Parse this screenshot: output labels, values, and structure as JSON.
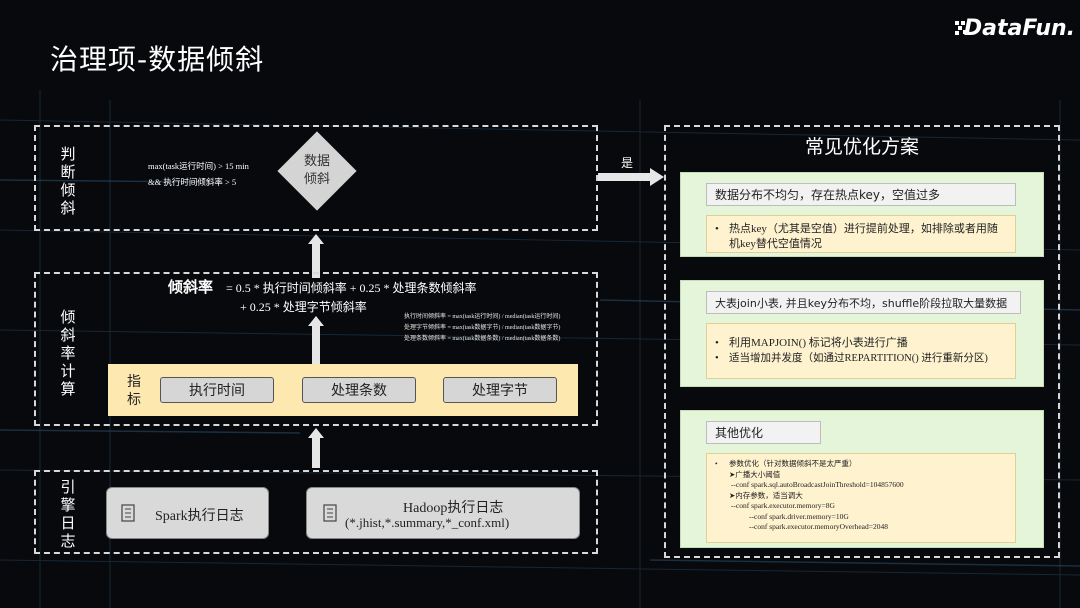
{
  "slide": {
    "title": "治理项-数据倾斜",
    "logo_text": "DataFun."
  },
  "judge": {
    "label": "判断倾斜",
    "condition_line1": "max(task运行时间) > 15 min",
    "condition_line2": "&&  执行时间倾斜率 > 5",
    "decision_line1": "数据",
    "decision_line2": "倾斜",
    "yes_label": "是"
  },
  "calc": {
    "label": "倾斜率计算",
    "formula_head": "倾斜率",
    "formula_line1": "= 0.5 * 执行时间倾斜率   + 0.25 * 处理条数倾斜率",
    "formula_line2": "+ 0.25 * 处理字节倾斜率",
    "defs": [
      "执行时间倾斜率 = max(task运行时间) / median(task运行时间)",
      "处理字节倾斜率 = max(task数据字节) / median(task数据字节)",
      "处理条数倾斜率 = max(task数据条数) / median(task数据条数)"
    ],
    "indicator_label": "指标",
    "indicators": [
      "执行时间",
      "处理条数",
      "处理字节"
    ]
  },
  "engine": {
    "label": "引擎日志",
    "spark": "Spark执行日志",
    "hadoop_line1": "Hadoop执行日志",
    "hadoop_line2": "(*.jhist,*.summary,*_conf.xml)"
  },
  "solutions": {
    "title": "常见优化方案",
    "cards": [
      {
        "header": "数据分布不均匀，存在热点key，空值过多",
        "items": [
          "热点key（尤其是空值）进行提前处理，如排除或者用随机key替代空值情况"
        ]
      },
      {
        "header": "大表join小表, 并且key分布不均，shuffle阶段拉取大量数据",
        "items": [
          "利用MAPJOIN() 标记将小表进行广播",
          "适当增加并发度（如通过REPARTITION() 进行重新分区)"
        ]
      },
      {
        "header": "其他优化",
        "item_title": "参数优化（针对数据倾斜不是太严重）",
        "lines": [
          "➤广播大小阈值",
          " --conf spark.sql.autoBroadcastJoinThreshold=104857600",
          "➤内存参数，适当调大",
          " --conf spark.executor.memory=8G",
          "--conf spark.driver.memory=10G",
          "--conf spark.executor.memoryOverhead=2048"
        ]
      }
    ]
  }
}
